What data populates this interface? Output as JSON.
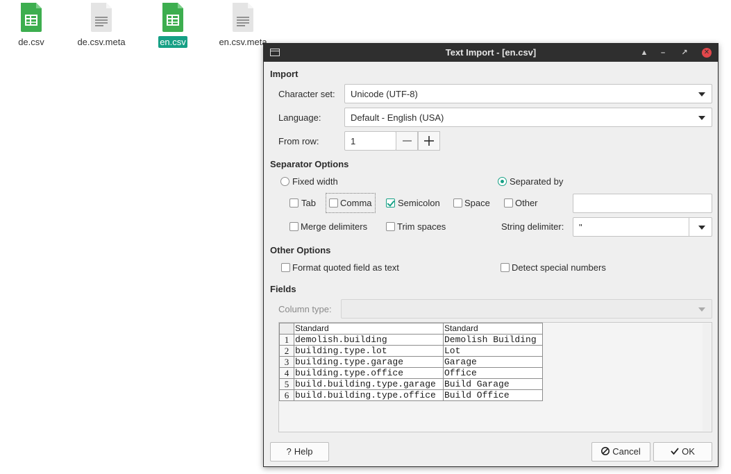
{
  "desktop": {
    "icons": [
      {
        "label": "de.csv",
        "type": "spreadsheet"
      },
      {
        "label": "de.csv.meta",
        "type": "text"
      },
      {
        "label": "en.csv",
        "type": "spreadsheet",
        "selected": true
      },
      {
        "label": "en.csv.meta",
        "type": "text"
      }
    ]
  },
  "dialog": {
    "title": "Text Import - [en.csv]",
    "import": {
      "section": "Import",
      "charset_label": "Character set:",
      "charset_value": "Unicode (UTF-8)",
      "language_label": "Language:",
      "language_value": "Default - English (USA)",
      "from_row_label": "From row:",
      "from_row_value": "1"
    },
    "separator": {
      "section": "Separator Options",
      "fixed_width": "Fixed width",
      "separated_by": "Separated by",
      "tab": "Tab",
      "comma": "Comma",
      "semicolon": "Semicolon",
      "space": "Space",
      "other": "Other",
      "merge_delimiters": "Merge delimiters",
      "trim_spaces": "Trim spaces",
      "string_delimiter_label": "String delimiter:",
      "string_delimiter_value": "\""
    },
    "other_options": {
      "section": "Other Options",
      "format_quoted": "Format quoted field as text",
      "detect_special": "Detect special numbers"
    },
    "fields": {
      "section": "Fields",
      "column_type_label": "Column type:",
      "headers": [
        "Standard",
        "Standard"
      ],
      "rows": [
        {
          "n": "1",
          "a": "demolish.building",
          "b": "Demolish Building"
        },
        {
          "n": "2",
          "a": "building.type.lot",
          "b": "Lot"
        },
        {
          "n": "3",
          "a": "building.type.garage",
          "b": "Garage"
        },
        {
          "n": "4",
          "a": "building.type.office",
          "b": "Office"
        },
        {
          "n": "5",
          "a": "build.building.type.garage",
          "b": "Build Garage"
        },
        {
          "n": "6",
          "a": "build.building.type.office",
          "b": "Build Office"
        }
      ]
    },
    "buttons": {
      "help": "Help",
      "cancel": "Cancel",
      "ok": "OK"
    }
  },
  "colors": {
    "accent": "#16a085",
    "titlebar": "#2f2f2f",
    "close": "#e2474b",
    "sheet_green": "#3dae4f"
  }
}
